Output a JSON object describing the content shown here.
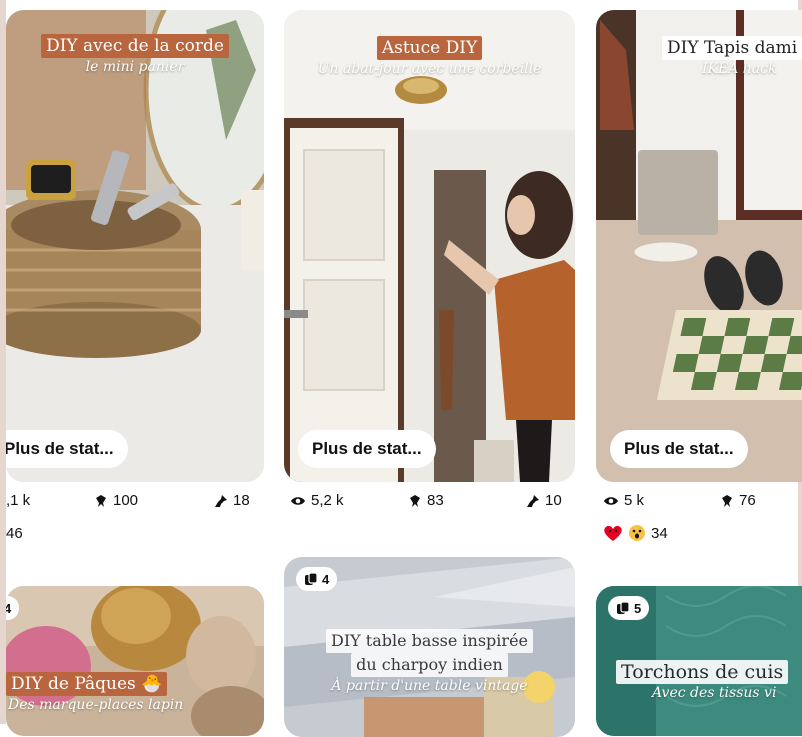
{
  "cards": [
    {
      "title": "DIY avec de la corde",
      "subtitle": "le mini panier",
      "stats_button": "Plus de stat...",
      "views": ",1 k",
      "saves": "100",
      "pins": "18",
      "reactions": "46"
    },
    {
      "title": "Astuce DIY",
      "subtitle": "Un abat-jour avec une corbeille",
      "stats_button": "Plus de stat...",
      "views": "5,2 k",
      "saves": "83",
      "pins": "10"
    },
    {
      "title": "DIY Tapis dami",
      "subtitle": "IKEA hack",
      "stats_button": "Plus de stat...",
      "views": "5 k",
      "saves": "76",
      "reactions": "34"
    }
  ],
  "bottom_cards": [
    {
      "badge": "4",
      "title": "DIY de Pâques 🐣",
      "subtitle": "Des marque-places lapin"
    },
    {
      "badge": "4",
      "title_line1": "DIY table basse inspirée",
      "title_line2": "du charpoy indien",
      "subtitle": "À partir d'une table vintage"
    },
    {
      "badge": "5",
      "title": "Torchons de cuis",
      "subtitle": "Avec des tissus vi"
    }
  ],
  "colors": {
    "accent_rust": "#b9663f",
    "pin_red": "#e60023"
  },
  "icons": [
    "eye-icon",
    "pin-save-icon",
    "pushpin-icon",
    "heart-reaction-icon",
    "wow-reaction-icon",
    "multi-pin-icon"
  ]
}
